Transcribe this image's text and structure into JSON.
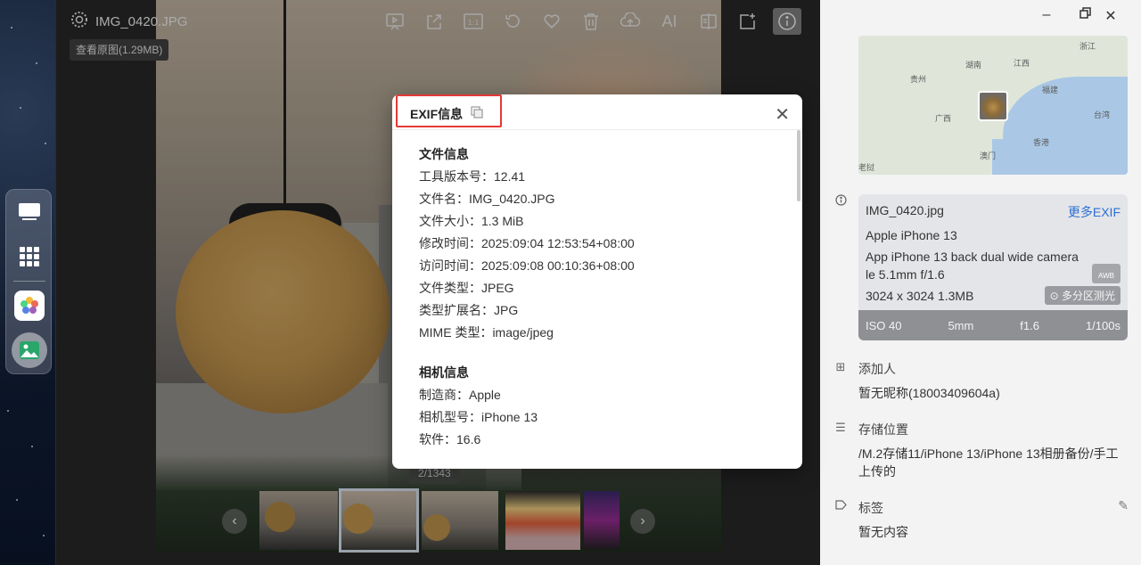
{
  "viewer": {
    "filename": "IMG_0420.JPG",
    "view_original": "查看原图(1.29MB)",
    "counter": "2/1343"
  },
  "toolbar_icons": [
    "slideshow-icon",
    "share-icon",
    "actual-size-icon",
    "rotate-icon",
    "favorite-icon",
    "delete-icon",
    "cloud-upload-icon",
    "ai-icon",
    "compare-icon",
    "export-icon",
    "info-icon"
  ],
  "toolbar_text": {
    "actual_size": "1:1",
    "ai": "AI"
  },
  "modal": {
    "title": "EXIF信息",
    "sections": [
      {
        "heading": "文件信息",
        "rows": [
          "工具版本号：12.41",
          "文件名：IMG_0420.JPG",
          "文件大小：1.3 MiB",
          "修改时间：2025:09:04 12:53:54+08:00",
          "访问时间：2025:09:08 00:10:36+08:00",
          "文件类型：JPEG",
          "类型扩展名：JPG",
          "MIME 类型：image/jpeg"
        ]
      },
      {
        "heading": "相机信息",
        "rows": [
          "制造商：Apple",
          "相机型号：iPhone 13",
          "软件：16.6"
        ]
      }
    ]
  },
  "panel": {
    "map_labels": [
      "浙江",
      "湖南",
      "江西",
      "贵州",
      "福建",
      "广西",
      "台湾",
      "香港",
      "澳门",
      "老挝"
    ],
    "exif_card": {
      "filename": "IMG_0420.jpg",
      "more": "更多EXIF",
      "device": "Apple iPhone 13",
      "lens_line1": "App iPhone 13 back dual wide camera",
      "lens_line2": "le    5.1mm f/1.6",
      "size": "3024 x 3024    1.3MB",
      "awb": "AWB",
      "metering": "多分区测光",
      "iso": "ISO 40",
      "focal": "5mm",
      "aperture": "f1.6",
      "shutter": "1/100s"
    },
    "adder_title": "添加人",
    "adder_value": "暂无昵称(18003409604a)",
    "storage_title": "存储位置",
    "storage_value": "/M.2存储11/iPhone 13/iPhone 13相册备份/手工上传的",
    "tags_title": "标签",
    "tags_value": "暂无内容"
  },
  "colors": {
    "accent_link": "#2d6fd6",
    "highlight_border": "#e53935"
  }
}
